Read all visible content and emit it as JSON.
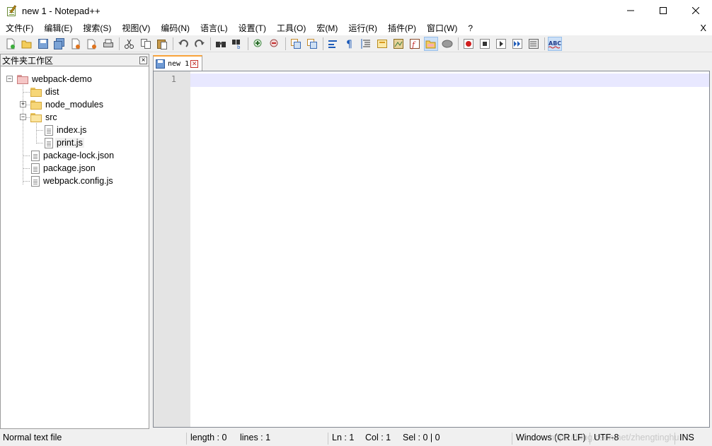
{
  "window": {
    "title": "new 1 - Notepad++",
    "app_icon": "notepad-plus-plus-icon"
  },
  "menu": {
    "items": [
      "文件(F)",
      "编辑(E)",
      "搜索(S)",
      "视图(V)",
      "编码(N)",
      "语言(L)",
      "设置(T)",
      "工具(O)",
      "宏(M)",
      "运行(R)",
      "插件(P)",
      "窗口(W)",
      "?"
    ],
    "close_label": "X"
  },
  "toolbar": {
    "icons": [
      "new-file-icon",
      "open-file-icon",
      "save-icon",
      "save-all-icon",
      "close-icon",
      "close-all-icon",
      "print-icon",
      "cut-icon",
      "copy-icon",
      "paste-icon",
      "undo-icon",
      "redo-icon",
      "find-icon",
      "replace-icon",
      "zoom-in-icon",
      "zoom-out-icon",
      "sync-vertical-icon",
      "sync-horizontal-icon",
      "word-wrap-icon",
      "show-all-chars-icon",
      "indent-guide-icon",
      "user-language-icon",
      "doc-map-icon",
      "function-list-icon",
      "folder-as-workspace-icon",
      "monitoring-icon",
      "record-macro-icon",
      "stop-record-icon",
      "play-macro-icon",
      "run-macro-multiple-icon",
      "save-macro-icon",
      "spell-check-icon"
    ],
    "spellcheck_label": "ABC"
  },
  "panel": {
    "title": "文件夹工作区",
    "close_label": "×",
    "tree": [
      {
        "label": "webpack-demo",
        "type": "root-folder"
      },
      {
        "label": "dist",
        "type": "folder"
      },
      {
        "label": "node_modules",
        "type": "folder"
      },
      {
        "label": "src",
        "type": "folder-open"
      },
      {
        "label": "index.js",
        "type": "file"
      },
      {
        "label": "print.js",
        "type": "file"
      },
      {
        "label": "package-lock.json",
        "type": "file"
      },
      {
        "label": "package.json",
        "type": "file"
      },
      {
        "label": "webpack.config.js",
        "type": "file"
      }
    ]
  },
  "editor": {
    "tab_label": "new 1",
    "line_numbers": [
      "1"
    ]
  },
  "status": {
    "file_type": "Normal text file",
    "length": "length : 0",
    "lines": "lines : 1",
    "ln": "Ln : 1",
    "col": "Col : 1",
    "sel": "Sel : 0 | 0",
    "eol": "Windows (CR LF)",
    "encoding": "UTF-8",
    "mode": "INS",
    "watermark": "https://blog.csdn.net/zhengtinghu"
  }
}
